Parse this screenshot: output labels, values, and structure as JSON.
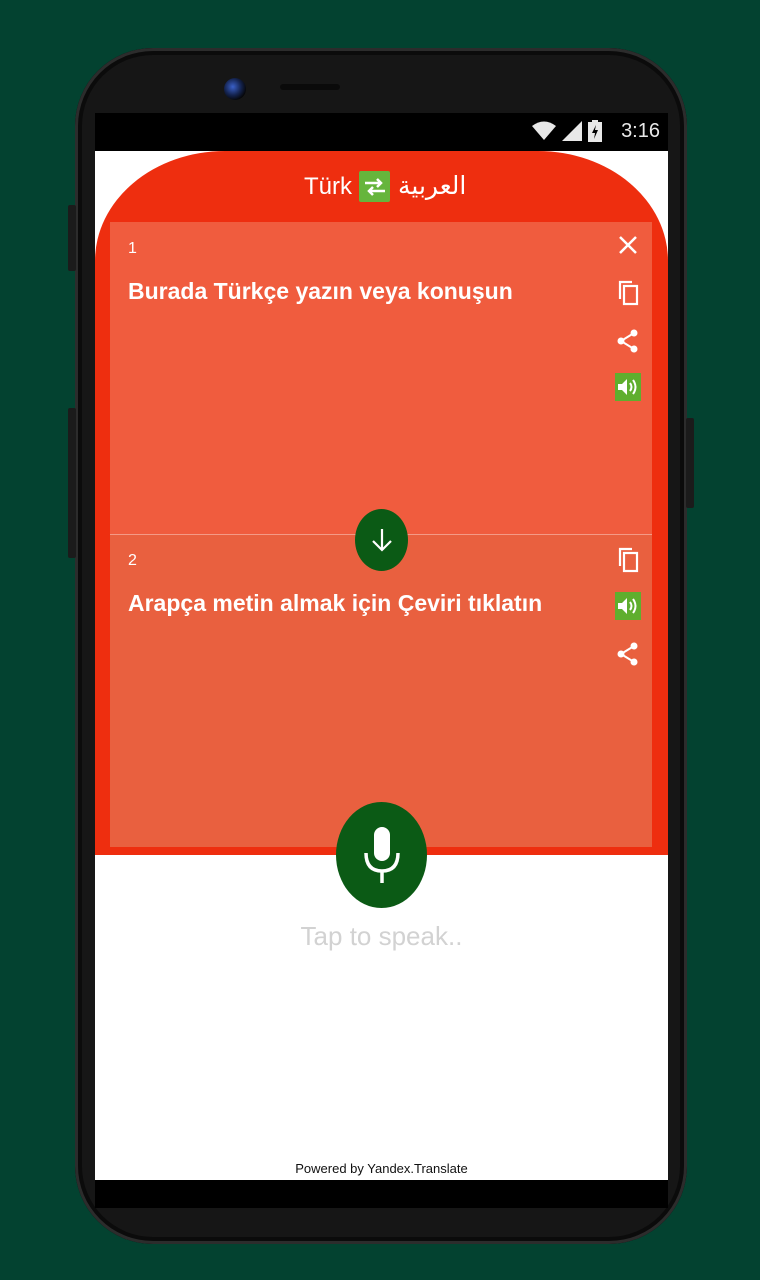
{
  "status_bar": {
    "time": "3:16"
  },
  "header": {
    "source_language": "Türk",
    "target_language": "العربية",
    "swap_icon": "swap-arrows-icon"
  },
  "input_card": {
    "number": "1",
    "placeholder_text": "Burada Türkçe yazın veya konuşun",
    "icons": [
      "close-icon",
      "copy-icon",
      "share-icon",
      "volume-icon"
    ]
  },
  "output_card": {
    "number": "2",
    "placeholder_text": "Arapça metin almak için Çeviri tıklatın",
    "icons": [
      "copy-icon",
      "volume-icon",
      "share-icon"
    ]
  },
  "translate_button_icon": "arrow-down-icon",
  "mic_button_icon": "microphone-icon",
  "tap_to_speak": "Tap to speak..",
  "footer": {
    "powered_by": "Powered by Yandex.Translate"
  },
  "colors": {
    "header_red": "#ee2e0f",
    "card_red": "#ef5a3c",
    "dark_green": "#0b5a15",
    "accent_green": "#5fae2e",
    "background": "#034230"
  }
}
